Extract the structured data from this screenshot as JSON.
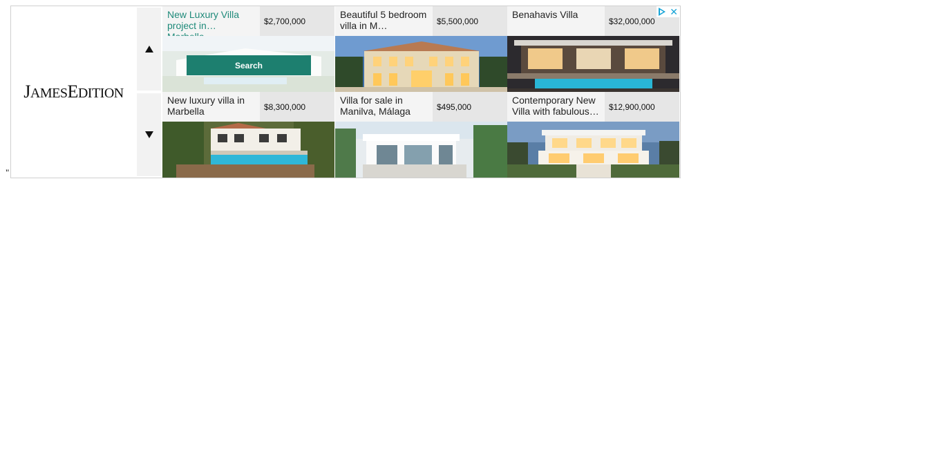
{
  "stray_text": "\"",
  "brand": {
    "name_prefix": "J",
    "name_part1": "AMES",
    "name_initial2": "E",
    "name_part2": "DITION"
  },
  "nav": {
    "up_icon": "triangle-up-icon",
    "down_icon": "triangle-down-icon"
  },
  "search_label": "Search",
  "ad_controls": {
    "adchoices_icon": "adchoices-icon",
    "close_glyph": "✕"
  },
  "listings": [
    {
      "title": "New Luxury Villa project in Marbella…",
      "price": "$2,700,000"
    },
    {
      "title": "Beautiful 5 bedroom villa in M…",
      "price": "$5,500,000"
    },
    {
      "title": "Benahavis Villa",
      "price": "$32,000,000"
    },
    {
      "title": "New luxury villa in Marbella",
      "price": "$8,300,000"
    },
    {
      "title": "Villa for sale in Manilva, Málaga",
      "price": "$495,000"
    },
    {
      "title": "Contemporary New Villa with fabulous…",
      "price": "$12,900,000"
    }
  ],
  "colors": {
    "accent": "#1d7f6f",
    "link_highlight": "#1f8a7a",
    "adchoices": "#16a3d6"
  }
}
